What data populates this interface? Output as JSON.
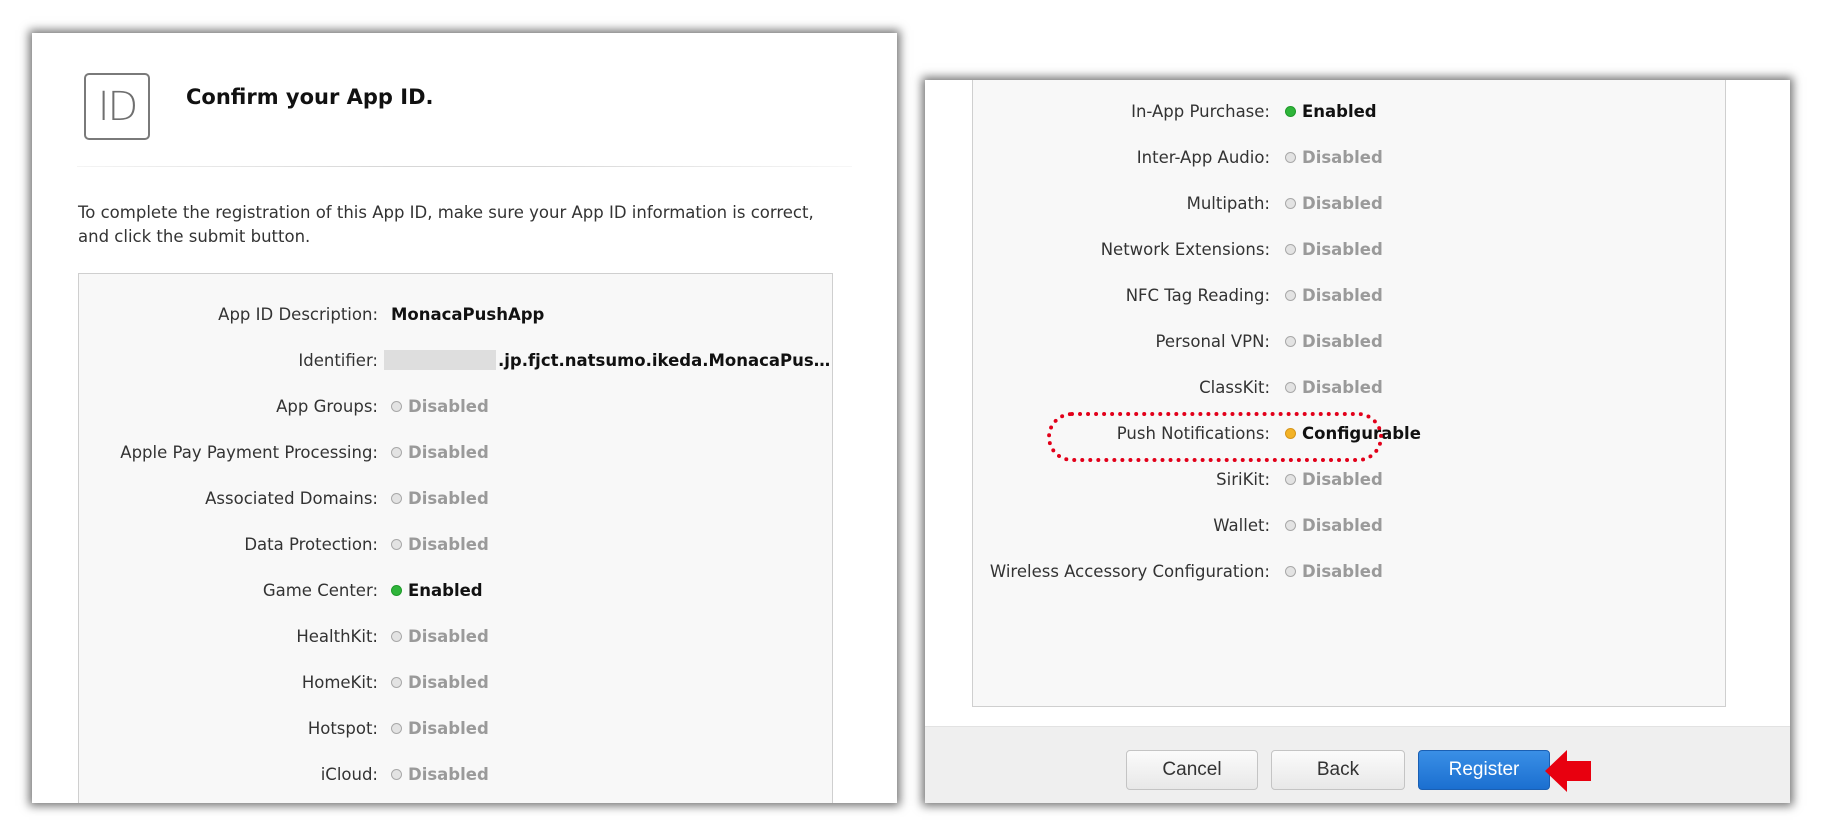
{
  "left_panel": {
    "icon_text": "ID",
    "title": "Confirm your App ID.",
    "intro": "To complete the registration of this App ID, make sure your App ID information is correct, and click the submit button.",
    "rows": [
      {
        "label": "App ID Description:",
        "value": "MonacaPushApp",
        "status": "text"
      },
      {
        "label": "Identifier:",
        "value": ".jp.fjct.natsumo.ikeda.MonacaPus…",
        "status": "identifier"
      },
      {
        "label": "App Groups:",
        "value": "Disabled",
        "status": "disabled"
      },
      {
        "label": "Apple Pay Payment Processing:",
        "value": "Disabled",
        "status": "disabled"
      },
      {
        "label": "Associated Domains:",
        "value": "Disabled",
        "status": "disabled"
      },
      {
        "label": "Data Protection:",
        "value": "Disabled",
        "status": "disabled"
      },
      {
        "label": "Game Center:",
        "value": "Enabled",
        "status": "enabled"
      },
      {
        "label": "HealthKit:",
        "value": "Disabled",
        "status": "disabled"
      },
      {
        "label": "HomeKit:",
        "value": "Disabled",
        "status": "disabled"
      },
      {
        "label": "Hotspot:",
        "value": "Disabled",
        "status": "disabled"
      },
      {
        "label": "iCloud:",
        "value": "Disabled",
        "status": "disabled"
      }
    ]
  },
  "right_panel": {
    "rows": [
      {
        "label": "In-App Purchase:",
        "value": "Enabled",
        "status": "enabled"
      },
      {
        "label": "Inter-App Audio:",
        "value": "Disabled",
        "status": "disabled"
      },
      {
        "label": "Multipath:",
        "value": "Disabled",
        "status": "disabled"
      },
      {
        "label": "Network Extensions:",
        "value": "Disabled",
        "status": "disabled"
      },
      {
        "label": "NFC Tag Reading:",
        "value": "Disabled",
        "status": "disabled"
      },
      {
        "label": "Personal VPN:",
        "value": "Disabled",
        "status": "disabled"
      },
      {
        "label": "ClassKit:",
        "value": "Disabled",
        "status": "disabled"
      },
      {
        "label": "Push Notifications:",
        "value": "Configurable",
        "status": "configurable"
      },
      {
        "label": "SiriKit:",
        "value": "Disabled",
        "status": "disabled"
      },
      {
        "label": "Wallet:",
        "value": "Disabled",
        "status": "disabled"
      },
      {
        "label": "Wireless Accessory Configuration:",
        "value": "Disabled",
        "status": "disabled"
      }
    ],
    "buttons": {
      "cancel": "Cancel",
      "back": "Back",
      "register": "Register"
    }
  },
  "colors": {
    "enabled": "#2fb53a",
    "configurable": "#f3b327",
    "disabled": "#e3e3e3",
    "primary_button": "#1b6fd0",
    "highlight": "#e2001a"
  },
  "icons": {
    "status_dot": "status-dot-icon",
    "annotation_arrow": "arrow-left-icon"
  }
}
